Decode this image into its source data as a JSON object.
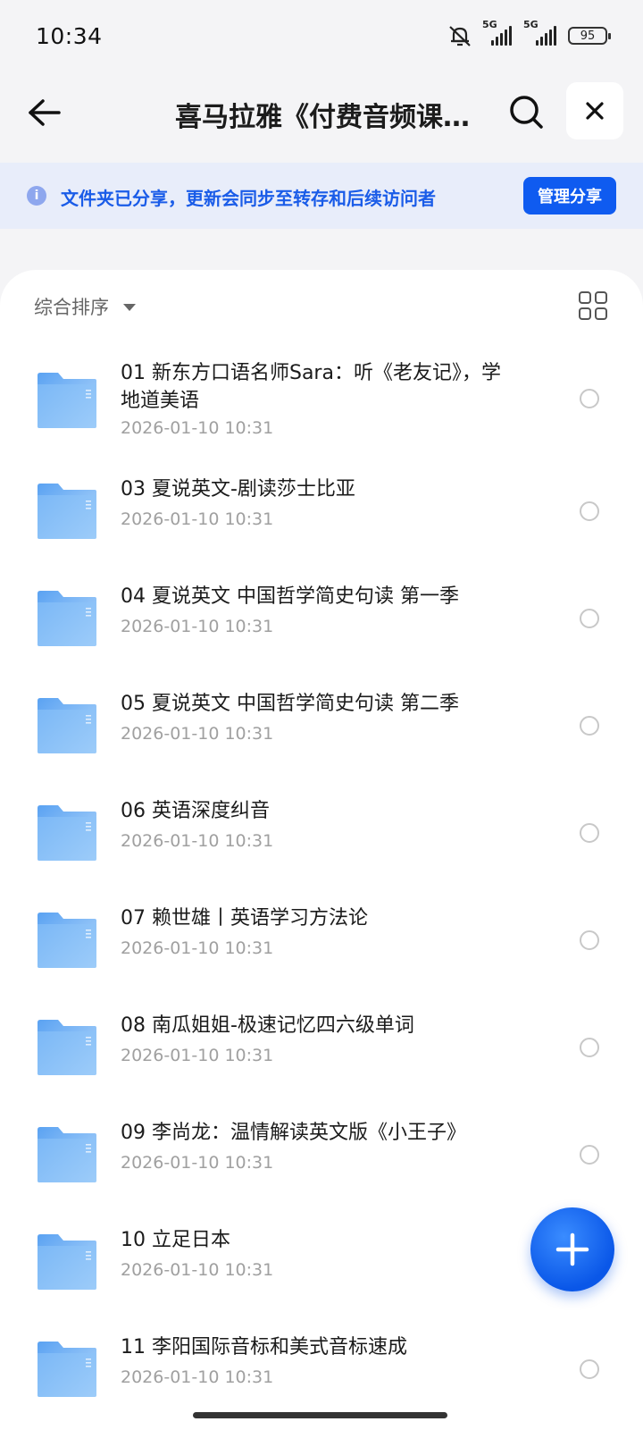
{
  "status_bar": {
    "time": "10:34",
    "network_1": "5G",
    "network_2": "5G",
    "battery": "95"
  },
  "header": {
    "title": "喜马拉雅《付费音频课…"
  },
  "banner": {
    "text": "文件夹已分享，更新会同步至转存和后续访问者",
    "manage_label": "管理分享"
  },
  "sort": {
    "label": "综合排序"
  },
  "files": [
    {
      "title": "01 新东方口语名师Sara：听《老友记》，学地道美语",
      "date": "2026-01-10 10:31"
    },
    {
      "title": "03 夏说英文-剧读莎士比亚",
      "date": "2026-01-10 10:31"
    },
    {
      "title": "04 夏说英文 中国哲学简史句读 第一季",
      "date": "2026-01-10 10:31"
    },
    {
      "title": "05 夏说英文 中国哲学简史句读 第二季",
      "date": "2026-01-10 10:31"
    },
    {
      "title": "06 英语深度纠音",
      "date": "2026-01-10 10:31"
    },
    {
      "title": "07 赖世雄丨英语学习方法论",
      "date": "2026-01-10 10:31"
    },
    {
      "title": "08 南瓜姐姐-极速记忆四六级单词",
      "date": "2026-01-10 10:31"
    },
    {
      "title": "09 李尚龙：温情解读英文版《小王子》",
      "date": "2026-01-10 10:31"
    },
    {
      "title": "10 立足日本",
      "date": "2026-01-10 10:31"
    },
    {
      "title": "11 李阳国际音标和美式音标速成",
      "date": "2026-01-10 10:31"
    }
  ],
  "colors": {
    "accent": "#0f5bf0",
    "banner_bg": "#e8edfa",
    "banner_text": "#1a5ce8",
    "folder": "#6aaef5"
  }
}
